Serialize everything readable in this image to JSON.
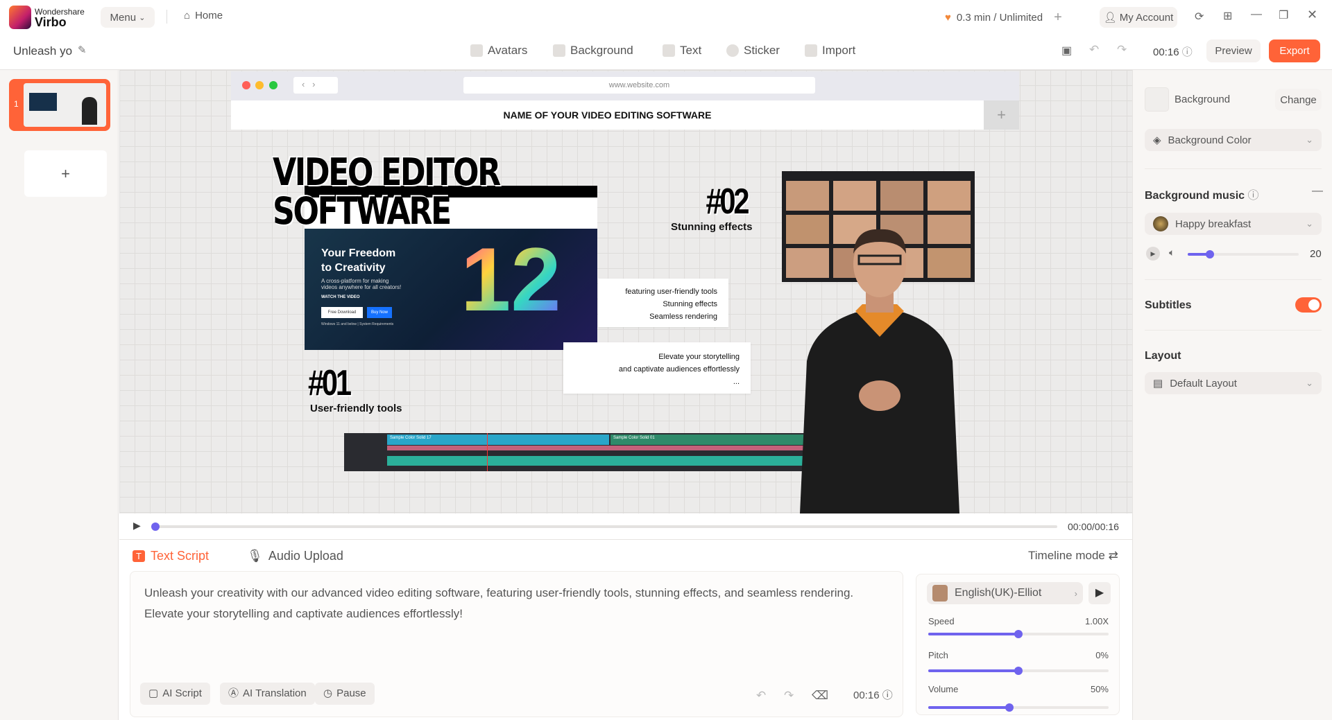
{
  "app": {
    "brand_top": "Wondershare",
    "brand_name": "Virbo",
    "menu": "Menu",
    "home": "Home",
    "usage": "0.3 min / Unlimited",
    "account": "My Account"
  },
  "toolbar": {
    "project_title": "Unleash yo",
    "tools": [
      "Avatars",
      "Background",
      "Text",
      "Sticker",
      "Import"
    ],
    "duration": "00:16",
    "preview": "Preview",
    "export": "Export"
  },
  "slides": {
    "items": [
      {
        "number": "1"
      }
    ],
    "add": "+"
  },
  "canvas": {
    "url": "www.website.com",
    "page_title": "NAME OF YOUR VIDEO EDITING SOFTWARE",
    "headline_1": "VIDEO EDITOR",
    "headline_2": "SOFTWARE",
    "hero_title_1": "Your Freedom",
    "hero_title_2": "to Creativity",
    "hero_sub": "A cross-platform for making videos anywhere for all creators!",
    "hero_watch": "WATCH THE VIDEO",
    "hero_free": "Free Download",
    "hero_buy": "Buy Now",
    "hero_note": "Windows 11 and below | System Requirements",
    "tag_01": "#01",
    "tag_01_label": "User-friendly tools",
    "tag_02": "#02",
    "tag_02_label": "Stunning effects",
    "box1": [
      "featuring user-friendly tools",
      "Stunning effects",
      "Seamless rendering"
    ],
    "box2": [
      "Elevate your storytelling",
      "and captivate audiences effortlessly",
      "..."
    ],
    "timeline_clips": [
      "Sample Color Solid 17",
      "Sample Color Solid 01"
    ]
  },
  "player": {
    "time": "00:00/00:16",
    "progress": 0
  },
  "script": {
    "tab_text": "Text Script",
    "tab_audio": "Audio Upload",
    "timeline_mode": "Timeline mode",
    "text_1": "Unleash your creativity with our advanced video editing software, featuring user-friendly tools, stunning effects, and seamless rendering.",
    "text_2": "Elevate your storytelling and captivate audiences effortlessly!",
    "ai_script": "AI Script",
    "ai_translation": "AI Translation",
    "pause": "Pause",
    "duration": "00:16"
  },
  "voice": {
    "name": "English(UK)-Elliot",
    "speed_label": "Speed",
    "speed": "1.00X",
    "speed_level": 0.5,
    "pitch_label": "Pitch",
    "pitch": "0%",
    "pitch_level": 0.5,
    "volume_label": "Volume",
    "volume": "50%",
    "volume_level": 0.45
  },
  "panel": {
    "background_label": "Background",
    "change": "Change",
    "background_color": "Background Color",
    "music_title": "Background music",
    "music_track": "Happy breakfast",
    "music_volume": "20",
    "music_level": 0.2,
    "subtitles": "Subtitles",
    "subtitles_on": true,
    "layout_title": "Layout",
    "layout_value": "Default Layout"
  },
  "colors": {
    "accent": "#ff6338",
    "slider": "#6f63ee"
  }
}
